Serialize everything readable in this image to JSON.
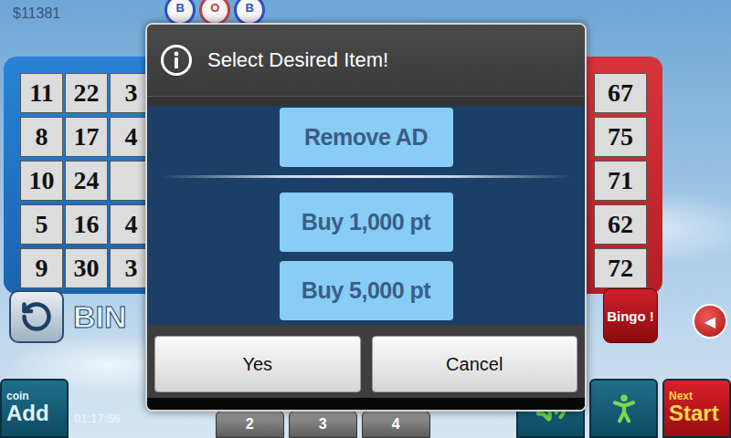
{
  "money": "$11381",
  "balls": [
    {
      "letter": "B",
      "color": "#2f4fc4"
    },
    {
      "letter": "O",
      "color": "#c93a3a"
    },
    {
      "letter": "B",
      "color": "#2f4fc4"
    }
  ],
  "left_card": {
    "rows": [
      [
        "11",
        "22",
        "3"
      ],
      [
        "8",
        "17",
        "4"
      ],
      [
        "10",
        "24",
        ""
      ],
      [
        "5",
        "16",
        "4"
      ],
      [
        "9",
        "30",
        "3"
      ]
    ]
  },
  "right_card": {
    "numbers": [
      "67",
      "75",
      "71",
      "62",
      "72"
    ]
  },
  "logo": "BIN",
  "bingo_button": "Bingo !",
  "arrow_button": "◀",
  "coin_button": {
    "caption": "coin",
    "label": "Add"
  },
  "timer": "01:17:56",
  "card_tabs": [
    "2",
    "3",
    "4"
  ],
  "next_button": {
    "caption": "Next",
    "label": "Start"
  },
  "dialog": {
    "title": "Select Desired Item!",
    "groups": [
      [
        "Remove AD"
      ],
      [
        "Buy 1,000 pt",
        "Buy 5,000 pt"
      ]
    ],
    "buttons": [
      "Yes",
      "Cancel"
    ]
  }
}
